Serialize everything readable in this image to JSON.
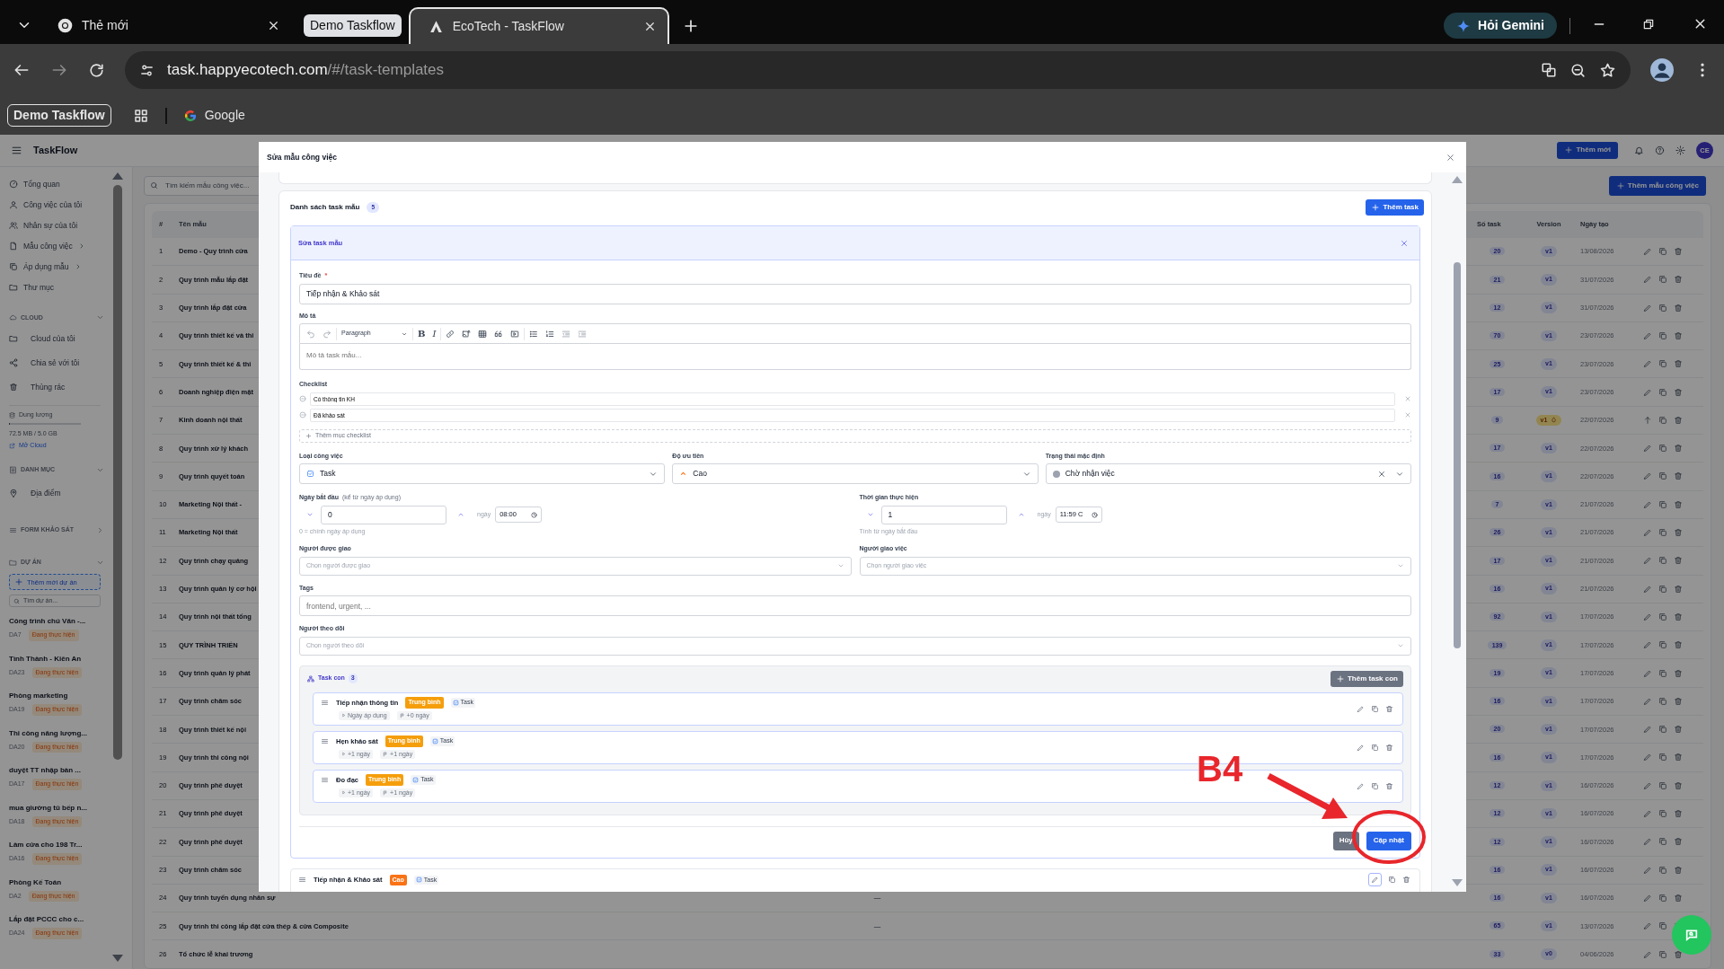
{
  "browser": {
    "tabs": [
      {
        "title": "Thẻ mới",
        "kind": "tab",
        "selected": false
      },
      {
        "title": "Demo Taskflow",
        "kind": "group",
        "selected": false
      },
      {
        "title": "EcoTech - TaskFlow",
        "kind": "tab",
        "selected": true
      }
    ],
    "gemini_button": "Hỏi Gemini",
    "url": {
      "domain": "task.happyecotech.com",
      "path": "/#/task-templates"
    },
    "bookmarks": [
      {
        "label": "Demo Taskflow",
        "kind": "group"
      },
      {
        "label": "Google",
        "kind": "site"
      }
    ]
  },
  "app": {
    "title": "TaskFlow",
    "add_button": "Thêm mới",
    "avatar": "CE"
  },
  "sidebar": {
    "main_items": [
      {
        "label": "Tổng quan",
        "submenu": false
      },
      {
        "label": "Công việc của tôi",
        "submenu": false
      },
      {
        "label": "Nhân sự của tôi",
        "submenu": false
      },
      {
        "label": "Mẫu công việc",
        "submenu": true
      },
      {
        "label": "Áp dụng mẫu",
        "submenu": true
      },
      {
        "label": "Thư mục",
        "submenu": false
      }
    ],
    "cloud": {
      "title": "CLOUD",
      "expanded": true,
      "items": [
        "Cloud của tôi",
        "Chia sẻ với tôi",
        "Thùng rác"
      ],
      "storage_label": "Dung lượng",
      "level": 0.015,
      "usage": "72.5 MB / 5.0 GB",
      "open_link": "Mở Cloud"
    },
    "categories": {
      "title": "DANH MỤC",
      "expanded": true,
      "items": [
        "Địa điểm"
      ]
    },
    "surveys": {
      "title": "FORM KHẢO SÁT",
      "expanded": false
    },
    "projects": {
      "title": "DỰ ÁN",
      "expanded": true,
      "add_button": "Thêm mới dự án",
      "search_placeholder": "Tìm dự án...",
      "items": [
        {
          "name": "Công trình chú Văn -...",
          "code": "DA7",
          "status": "Đang thực hiện"
        },
        {
          "name": "Tình Thành - Kiên An",
          "code": "DA23",
          "status": "Đang thực hiện"
        },
        {
          "name": "Phòng marketing",
          "code": "DA19",
          "status": "Đang thực hiện"
        },
        {
          "name": "Thi công năng lượng...",
          "code": "DA20",
          "status": "Đang thực hiện"
        },
        {
          "name": "duyệt TT nhập bàn ...",
          "code": "DA17",
          "status": "Đang thực hiện"
        },
        {
          "name": "mua giường tủ bếp n...",
          "code": "DA18",
          "status": "Đang thực hiện"
        },
        {
          "name": "Làm cửa cho 198 Tr...",
          "code": "DA16",
          "status": "Đang thực hiện"
        },
        {
          "name": "Phòng Kế Toán",
          "code": "DA2",
          "status": "Đang thực hiện"
        },
        {
          "name": "Lắp đặt PCCC cho c...",
          "code": "DA24",
          "status": "Đang thực hiện"
        }
      ]
    }
  },
  "templates": {
    "search_placeholder": "Tìm kiếm mẫu công việc...",
    "add_button": "Thêm mẫu công việc",
    "columns": [
      "#",
      "Tên mẫu",
      "Số task",
      "Version",
      "Ngày tạo"
    ],
    "rows": [
      {
        "no": "1",
        "name": "Demo - Quy trình cửa",
        "tasks": "20",
        "version": "v1",
        "draft": false,
        "date": "13/08/2026"
      },
      {
        "no": "2",
        "name": "Quy trình mẫu lắp đặt",
        "tasks": "21",
        "version": "v1",
        "draft": false,
        "date": "31/07/2026"
      },
      {
        "no": "3",
        "name": "Quy trình lắp đặt cửa",
        "tasks": "12",
        "version": "v1",
        "draft": false,
        "date": "31/07/2026"
      },
      {
        "no": "4",
        "name": "Quy trình thiết kế và thi",
        "tasks": "70",
        "version": "v1",
        "draft": false,
        "date": "23/07/2026"
      },
      {
        "no": "5",
        "name": "Quy trình thiết kế & thi",
        "tasks": "25",
        "version": "v1",
        "draft": false,
        "date": "23/07/2026"
      },
      {
        "no": "6",
        "name": "Doanh nghiệp điện mặt",
        "tasks": "17",
        "version": "v1",
        "draft": false,
        "date": "23/07/2026"
      },
      {
        "no": "7",
        "name": "Kinh doanh nội thất",
        "tasks": "9",
        "version": "v1",
        "draft": true,
        "date": "22/07/2026"
      },
      {
        "no": "8",
        "name": "Quy trình xử lý khách",
        "tasks": "17",
        "version": "v1",
        "draft": false,
        "date": "22/07/2026"
      },
      {
        "no": "9",
        "name": "Quy trình quyết toán",
        "tasks": "16",
        "version": "v1",
        "draft": false,
        "date": "22/07/2026"
      },
      {
        "no": "10",
        "name": "Marketing Nội thất -",
        "tasks": "7",
        "version": "v1",
        "draft": false,
        "date": "21/07/2026"
      },
      {
        "no": "11",
        "name": "Marketing Nội thất",
        "tasks": "26",
        "version": "v1",
        "draft": false,
        "date": "21/07/2026"
      },
      {
        "no": "12",
        "name": "Quy trình chạy quảng",
        "tasks": "17",
        "version": "v1",
        "draft": false,
        "date": "21/07/2026"
      },
      {
        "no": "13",
        "name": "Quy trình quản lý cơ hội",
        "tasks": "16",
        "version": "v1",
        "draft": false,
        "date": "21/07/2026"
      },
      {
        "no": "14",
        "name": "Quy trình nội thất tổng",
        "tasks": "92",
        "version": "v1",
        "draft": false,
        "date": "17/07/2026"
      },
      {
        "no": "15",
        "name": "QUY TRÌNH TRIỂN",
        "tasks": "139",
        "version": "v1",
        "draft": false,
        "date": "17/07/2026"
      },
      {
        "no": "16",
        "name": "Quy trình quản lý phát",
        "tasks": "19",
        "version": "v1",
        "draft": false,
        "date": "17/07/2026"
      },
      {
        "no": "17",
        "name": "Quy trình chăm sóc",
        "tasks": "16",
        "version": "v1",
        "draft": false,
        "date": "17/07/2026"
      },
      {
        "no": "18",
        "name": "Quy trình thiết kế nội",
        "tasks": "20",
        "version": "v1",
        "draft": false,
        "date": "17/07/2026"
      },
      {
        "no": "19",
        "name": "Quy trình thi công nội",
        "tasks": "16",
        "version": "v1",
        "draft": false,
        "date": "17/07/2026"
      },
      {
        "no": "20",
        "name": "Quy trình phê duyệt",
        "tasks": "12",
        "version": "v1",
        "draft": false,
        "date": "16/07/2026"
      },
      {
        "no": "21",
        "name": "Quy trình phê duyệt",
        "tasks": "12",
        "version": "v1",
        "draft": false,
        "date": "16/07/2026"
      },
      {
        "no": "22",
        "name": "Quy trình phê duyệt",
        "tasks": "12",
        "version": "v1",
        "draft": false,
        "date": "16/07/2026"
      },
      {
        "no": "23",
        "name": "Quy trình chăm sóc",
        "tasks": "16",
        "version": "v1",
        "draft": false,
        "date": "16/07/2026"
      },
      {
        "no": "24",
        "name": "Quy trình tuyển dụng nhân sự",
        "column_3": "—",
        "tasks": "16",
        "version": "v1",
        "draft": false,
        "date": "16/07/2026"
      },
      {
        "no": "25",
        "name": "Quy trình thi công lắp đặt cửa thép & cửa Composite",
        "column_3": "—",
        "tasks": "65",
        "version": "v1",
        "draft": false,
        "date": "13/07/2026"
      },
      {
        "no": "26",
        "name": "Tổ chức lễ khai trương",
        "tasks": "33",
        "version": "v0",
        "draft": false,
        "date": "04/06/2026"
      }
    ]
  },
  "modal": {
    "title": "Sửa mẫu công việc",
    "task_list": {
      "title": "Danh sách task mẫu",
      "count": "5",
      "add_button": "Thêm task",
      "editor": {
        "title": "Sửa task mẫu",
        "title_label": "Tiêu đề",
        "required_mark": "*",
        "title_value": "Tiếp nhận & Khảo sát",
        "description_label": "Mô tả",
        "style_select": "Paragraph",
        "format_marks": [
          "B",
          "I"
        ],
        "description_placeholder": "Mô tả task mẫu...",
        "checklist_label": "Checklist",
        "checklist": [
          "Có thông tin KH",
          "Đã khảo sát"
        ],
        "add_checklist": "Thêm mục checklist",
        "type": {
          "label": "Loại công việc",
          "value": "Task"
        },
        "priority": {
          "label": "Độ ưu tiên",
          "value": "Cao",
          "color": "#f97316"
        },
        "status": {
          "label": "Trạng thái mặc định",
          "value": "Chờ nhận việc",
          "color": "#9ca3af"
        },
        "start": {
          "label": "Ngày bắt đầu",
          "note": "(kể từ ngày áp dụng)",
          "value": "0",
          "unit": "ngày",
          "time": "08:00",
          "hint": "0 = chính ngày áp dụng"
        },
        "duration": {
          "label": "Thời gian thực hiện",
          "value": "1",
          "unit": "ngày",
          "time": "11:59 C",
          "hint": "Tính từ ngày bắt đầu"
        },
        "assignee": {
          "label": "Người được giao",
          "placeholder": "Chọn người được giao"
        },
        "assigner": {
          "label": "Người giao việc",
          "placeholder": "Chọn người giao việc"
        },
        "tags": {
          "label": "Tags",
          "placeholder": "frontend, urgent, ..."
        },
        "watchers": {
          "label": "Người theo dõi",
          "placeholder": "Chọn người theo dõi"
        },
        "subtasks": {
          "title": "Task con",
          "count": "3",
          "add_button": "Thêm task con",
          "items": [
            {
              "title": "Tiếp nhận thông tin",
              "priority": "Trung bình",
              "color": "#f59e0b",
              "type": "Task",
              "start": "Ngày áp dụng",
              "duration": "+0 ngày"
            },
            {
              "title": "Hẹn khảo sát",
              "priority": "Trung bình",
              "color": "#f59e0b",
              "type": "Task",
              "start": "+1 ngày",
              "duration": "+1 ngày"
            },
            {
              "title": "Đo đạc",
              "priority": "Trung bình",
              "color": "#f59e0b",
              "type": "Task",
              "start": "+1 ngày",
              "duration": "+1 ngày"
            }
          ]
        },
        "cancel_button": "Hủy",
        "save_button": "Cập nhật"
      },
      "next_task": {
        "title": "Tiếp nhận & Khảo sát",
        "priority": "Cao",
        "color": "#f97316",
        "type": "Task"
      }
    }
  },
  "annotation": {
    "label": "B4"
  }
}
